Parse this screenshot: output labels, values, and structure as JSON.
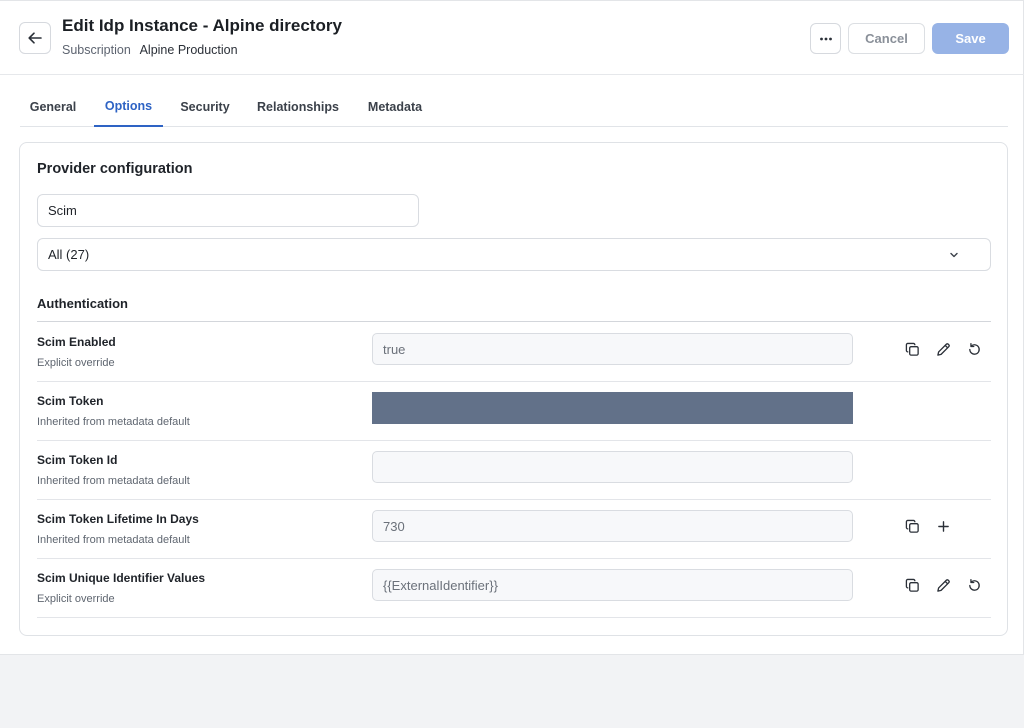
{
  "header": {
    "title": "Edit Idp Instance - Alpine directory",
    "subscription_label": "Subscription",
    "subscription_value": "Alpine Production",
    "cancel_label": "Cancel",
    "save_label": "Save"
  },
  "tabs": [
    {
      "label": "General"
    },
    {
      "label": "Options",
      "active": true
    },
    {
      "label": "Security"
    },
    {
      "label": "Relationships"
    },
    {
      "label": "Metadata"
    }
  ],
  "card": {
    "title": "Provider configuration",
    "filter_value": "Scim",
    "select_value": "All (27)",
    "section_title": "Authentication"
  },
  "rows": [
    {
      "name": "Scim Enabled",
      "source": "Explicit override",
      "value": "true",
      "actions": [
        "copy-icon",
        "edit-icon",
        "reset-icon"
      ]
    },
    {
      "name": "Scim Token",
      "source": "Inherited from metadata default",
      "value": "",
      "masked": true,
      "actions": []
    },
    {
      "name": "Scim Token Id",
      "source": "Inherited from metadata default",
      "value": "",
      "actions": []
    },
    {
      "name": "Scim Token Lifetime In Days",
      "source": "Inherited from metadata default",
      "value": "730",
      "actions": [
        "copy-icon",
        "add-icon"
      ]
    },
    {
      "name": "Scim Unique Identifier Values",
      "source": "Explicit override",
      "value": "{{ExternalIdentifier}}",
      "actions": [
        "copy-icon",
        "edit-icon",
        "reset-icon"
      ]
    }
  ],
  "colors": {
    "accent": "#2e63c4",
    "save_disabled": "#97b3e6",
    "masked_field": "#627189"
  }
}
